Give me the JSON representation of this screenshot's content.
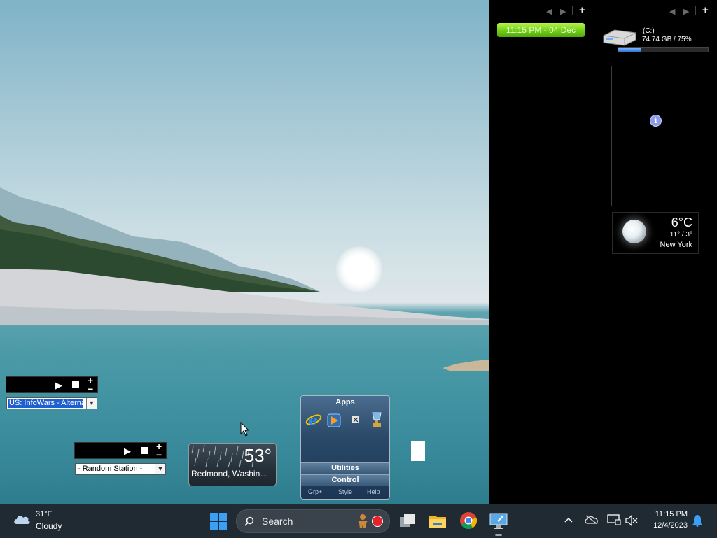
{
  "sidebar": {
    "prev_label": "◀",
    "next_label": "▶",
    "add_label": "+",
    "clock": {
      "time": "11:15 PM",
      "separator": " - ",
      "date": "04 Dec"
    },
    "drive": {
      "label": "(C:)",
      "size": "74.74 GB / 75%",
      "used_fraction": 0.25
    },
    "slideshow": {
      "info_glyph": "i"
    },
    "weather": {
      "temp": "6°C",
      "range": "11° / 3°",
      "city": "New York"
    }
  },
  "radio1": {
    "station": "US: InfoWars - Alterna",
    "add": "+",
    "remove": "−"
  },
  "radio2": {
    "station": "- Random Station -",
    "add": "+",
    "remove": "−"
  },
  "weather_gadget": {
    "temp": "53°",
    "city": "Redmond, Washington"
  },
  "apps_gadget": {
    "title": "Apps",
    "icons": [
      "internet-explorer-icon",
      "media-player-icon",
      "small-app-icon",
      "trophy-icon"
    ],
    "rows": [
      "Utilities",
      "Control"
    ],
    "footer": [
      "Grp+",
      "Style",
      "Help"
    ]
  },
  "taskbar": {
    "weather_temp": "31°F",
    "weather_cond": "Cloudy",
    "search_placeholder": "Search",
    "apps": [
      "task-view-icon",
      "file-explorer-icon",
      "chrome-icon",
      "remote-desktop-icon"
    ],
    "tray_icons": [
      "chevron-up-icon",
      "onedrive-icon",
      "display-icon",
      "speaker-muted-icon"
    ],
    "time": "11:15 PM",
    "date": "12/4/2023",
    "notification_icon": "bell-icon"
  },
  "colors": {
    "taskbar_bg": "#202a33",
    "clock_green": "#76d11c",
    "accent_blue": "#2f73d8"
  }
}
